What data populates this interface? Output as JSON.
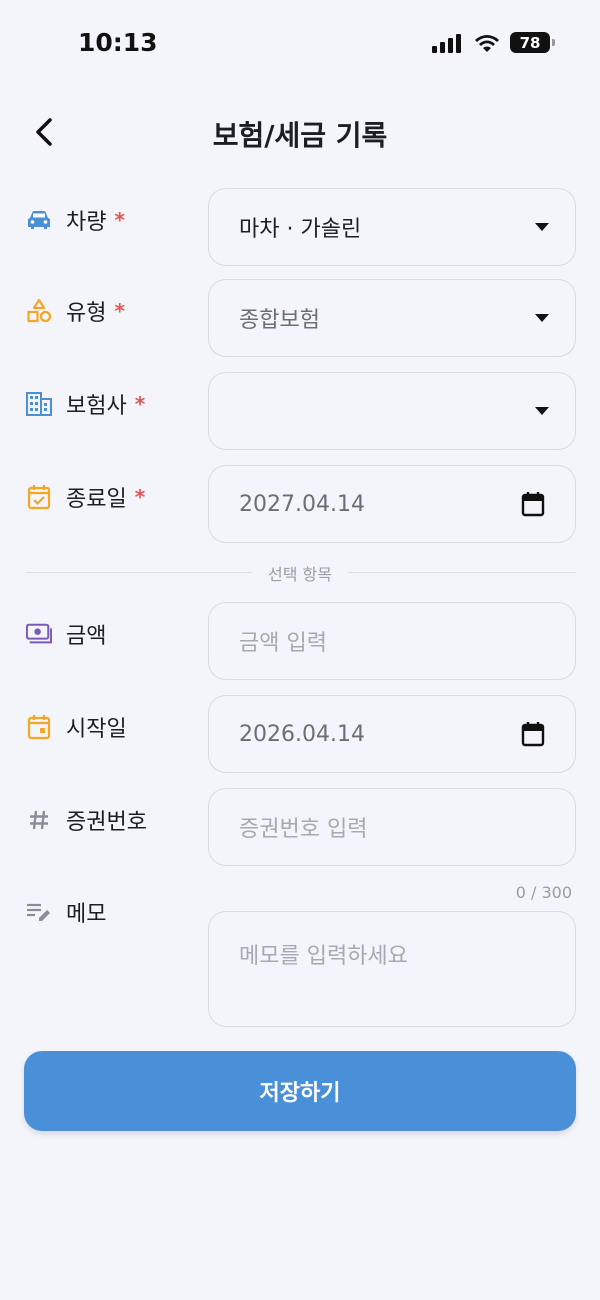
{
  "status_bar": {
    "time": "10:13",
    "battery": "78"
  },
  "header": {
    "title": "보험/세금 기록"
  },
  "fields": {
    "vehicle": {
      "label": "차량",
      "required_mark": "*",
      "value": "마차 · 가솔린"
    },
    "type": {
      "label": "유형",
      "required_mark": "*",
      "value": "종합보험"
    },
    "insurer": {
      "label": "보험사",
      "required_mark": "*",
      "value": ""
    },
    "end_date": {
      "label": "종료일",
      "required_mark": "*",
      "value": "2027.04.14"
    },
    "optional_divider": "선택 항목",
    "amount": {
      "label": "금액",
      "placeholder": "금액 입력"
    },
    "start_date": {
      "label": "시작일",
      "value": "2026.04.14"
    },
    "policy_number": {
      "label": "증권번호",
      "placeholder": "증권번호 입력"
    },
    "memo": {
      "label": "메모",
      "placeholder": "메모를 입력하세요",
      "counter": "0 / 300"
    }
  },
  "save_button": {
    "label": "저장하기"
  },
  "colors": {
    "accent": "#4a90d9",
    "required": "#e25555",
    "vehicle_icon": "#4a90d9",
    "type_icon": "#f5a623",
    "insurer_icon": "#4a90d9",
    "end_date_icon": "#f5a623",
    "amount_icon": "#7b5bb5",
    "start_date_icon": "#f5a623",
    "policy_icon": "#8a8c96",
    "memo_icon": "#8a8c96"
  },
  "icons": {
    "vehicle": "car-icon",
    "type": "shapes-icon",
    "insurer": "building-icon",
    "end_date": "calendar-check-icon",
    "amount": "cash-icon",
    "start_date": "calendar-icon",
    "policy_number": "hash-icon",
    "memo": "edit-note-icon",
    "date_picker": "calendar-icon"
  }
}
